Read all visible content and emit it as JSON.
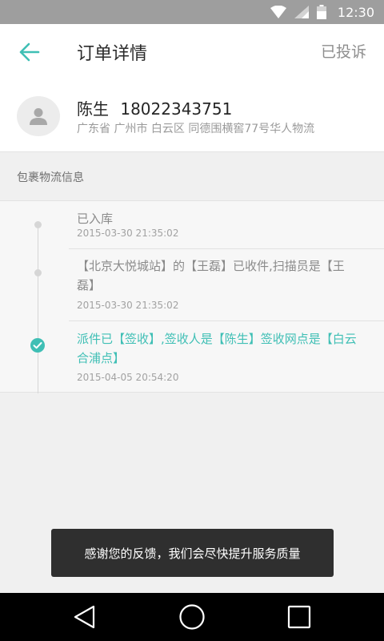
{
  "status_bar": {
    "time": "12:30",
    "icons": [
      "wifi-icon",
      "signal-icon",
      "battery-icon"
    ]
  },
  "header": {
    "title": "订单详情",
    "action": "已投诉"
  },
  "recipient": {
    "name": "陈生",
    "phone": "18022343751",
    "address": "广东省 广州市 白云区 同德围横窖77号华人物流"
  },
  "section": {
    "title": "包裹物流信息"
  },
  "timeline": [
    {
      "text": "已入库",
      "time": "2015-03-30 21:35:02",
      "state": "done"
    },
    {
      "text": "【北京大悦城站】的【王磊】已收件,扫描员是【王磊】",
      "time": "2015-03-30 21:35:02",
      "state": "done"
    },
    {
      "text": "派件已【签收】,签收人是【陈生】签收网点是【白云合浦点】",
      "time": "2015-04-05 20:54:20",
      "state": "current"
    }
  ],
  "toast": {
    "message": "感谢您的反馈，我们会尽快提升服务质量"
  },
  "colors": {
    "accent": "#3fbfb5",
    "status_bar": "#9e9e9e",
    "nav_bar": "#000000"
  }
}
